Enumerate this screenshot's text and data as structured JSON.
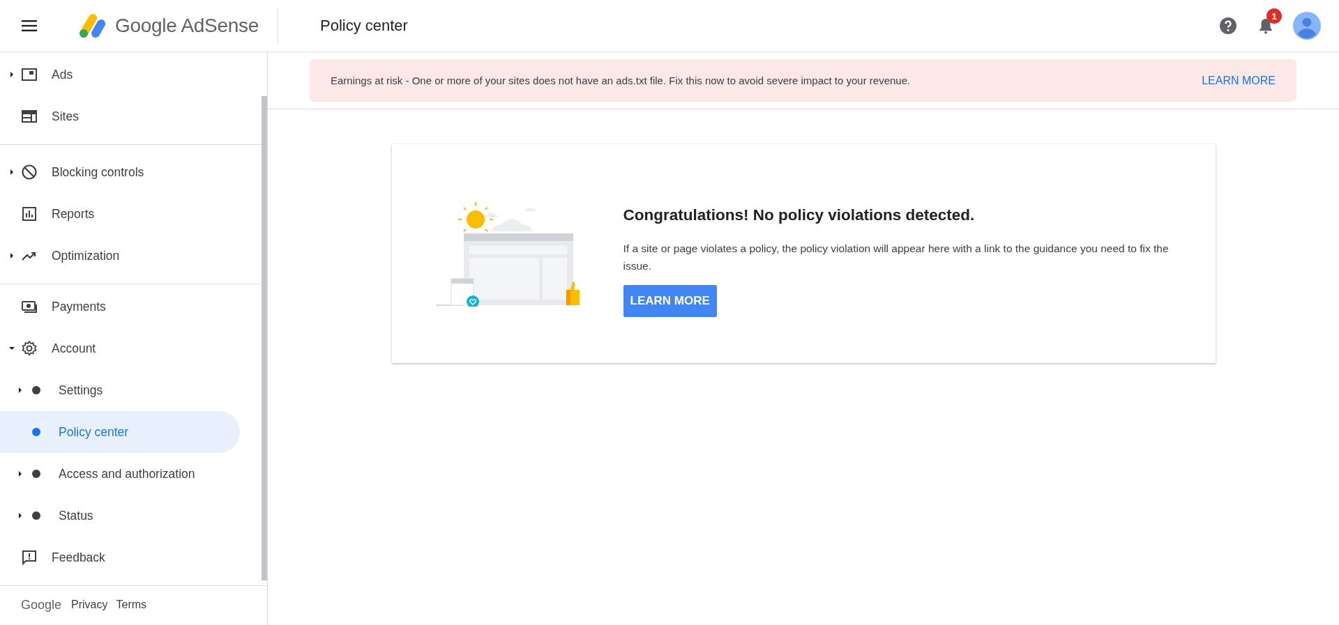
{
  "header": {
    "product": "Google AdSense",
    "page_title": "Policy center",
    "notifications": {
      "count": "1"
    }
  },
  "sidebar": {
    "sections": [
      [
        {
          "label": "Ads",
          "expanded": false,
          "selected": false
        },
        {
          "label": "Sites",
          "selected": false
        }
      ],
      [
        {
          "label": "Blocking controls",
          "expanded": false,
          "selected": false
        },
        {
          "label": "Reports",
          "selected": false
        },
        {
          "label": "Optimization",
          "expanded": false,
          "selected": false
        }
      ],
      [
        {
          "label": "Payments",
          "selected": false
        },
        {
          "label": "Account",
          "expanded": true,
          "selected": false,
          "children": [
            {
              "label": "Settings",
              "expanded": false,
              "selected": false
            },
            {
              "label": "Policy center",
              "selected": true
            },
            {
              "label": "Access and authorization",
              "expanded": false,
              "selected": false
            },
            {
              "label": "Status",
              "expanded": false,
              "selected": false
            }
          ]
        },
        {
          "label": "Feedback",
          "selected": false
        }
      ]
    ],
    "footer": {
      "brand": "Google",
      "links": [
        "Privacy",
        "Terms"
      ]
    }
  },
  "banner": {
    "message": "Earnings at risk - One or more of your sites does not have an ads.txt file. Fix this now to avoid severe impact to your revenue.",
    "action": "LEARN MORE"
  },
  "card": {
    "title": "Congratulations! No policy violations detected.",
    "body": "If a site or page violates a policy, the policy violation will appear here with a link to the guidance you need to fix the issue.",
    "button": "LEARN MORE"
  }
}
